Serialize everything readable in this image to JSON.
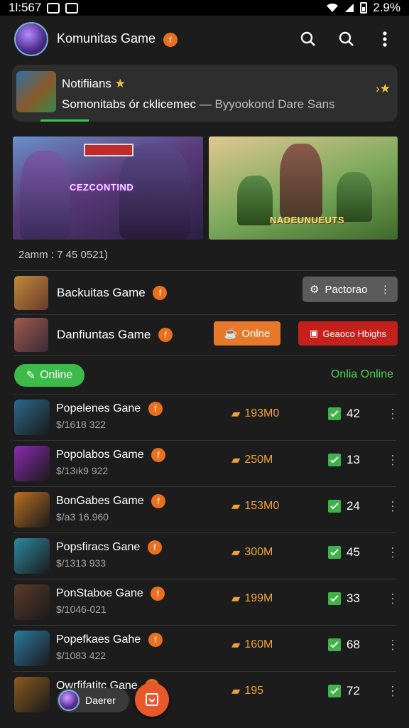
{
  "status_bar": {
    "time": "1l:567",
    "battery": "2.9%"
  },
  "app_bar": {
    "title": "Komunitas Game",
    "badge": "f"
  },
  "notification": {
    "title": "Notifiians",
    "subtitle": "Somonitabs ór cklicemec",
    "separator": "—",
    "source": "Byyookond Dare Sans",
    "progress": 0.3
  },
  "banners": [
    {
      "caption": "CEZCONTIND"
    },
    {
      "caption": "NADEUNUEUTS"
    }
  ],
  "section_label": "2amm : 7 45 0521)",
  "featured": [
    {
      "name": "Backuitas Game",
      "badge": "f",
      "button": "Pactorao"
    },
    {
      "name": "Danfiuntas Game",
      "badge": "f",
      "button_online": "Onlne",
      "button_red": "Geaoco Hbighs"
    }
  ],
  "filter": {
    "pill": "Online",
    "right": "Onlia Online"
  },
  "games": [
    {
      "name": "Popelenes Gane",
      "sub": "$/1618 322",
      "downloads": "193M0",
      "count": "42",
      "color": "#2a6a8a"
    },
    {
      "name": "Popolabos Game",
      "sub": "$/13ık9 922",
      "downloads": "250M",
      "count": "13",
      "color": "#8a2ab0"
    },
    {
      "name": "BonGabes Game",
      "sub": "$/a3 16.960",
      "downloads": "153M0",
      "count": "24",
      "color": "#b87020"
    },
    {
      "name": "Popsfiracs Gane",
      "sub": "$/1313 933",
      "downloads": "300M",
      "count": "45",
      "color": "#2a8aa0"
    },
    {
      "name": "PonStaboe Gane",
      "sub": "$/1046-021",
      "downloads": "199M",
      "count": "33",
      "color": "#5a3a2a"
    },
    {
      "name": "Popefkaes Gahe",
      "sub": "$/1083 422",
      "downloads": "160M",
      "count": "68",
      "color": "#2a7aa0"
    },
    {
      "name": "Owrfifatitc Gane",
      "sub": "",
      "downloads": "195",
      "count": "72",
      "color": "#8a5a20"
    }
  ],
  "chip": {
    "label": "Daerer"
  },
  "colors": {
    "accent_orange": "#e8792a",
    "accent_green": "#3cba4a",
    "danger_red": "#c4211c"
  },
  "icons": [
    "search-icon",
    "search-icon",
    "more-vert-icon",
    "star-icon",
    "check-icon",
    "download-icon",
    "more-vert-icon"
  ]
}
